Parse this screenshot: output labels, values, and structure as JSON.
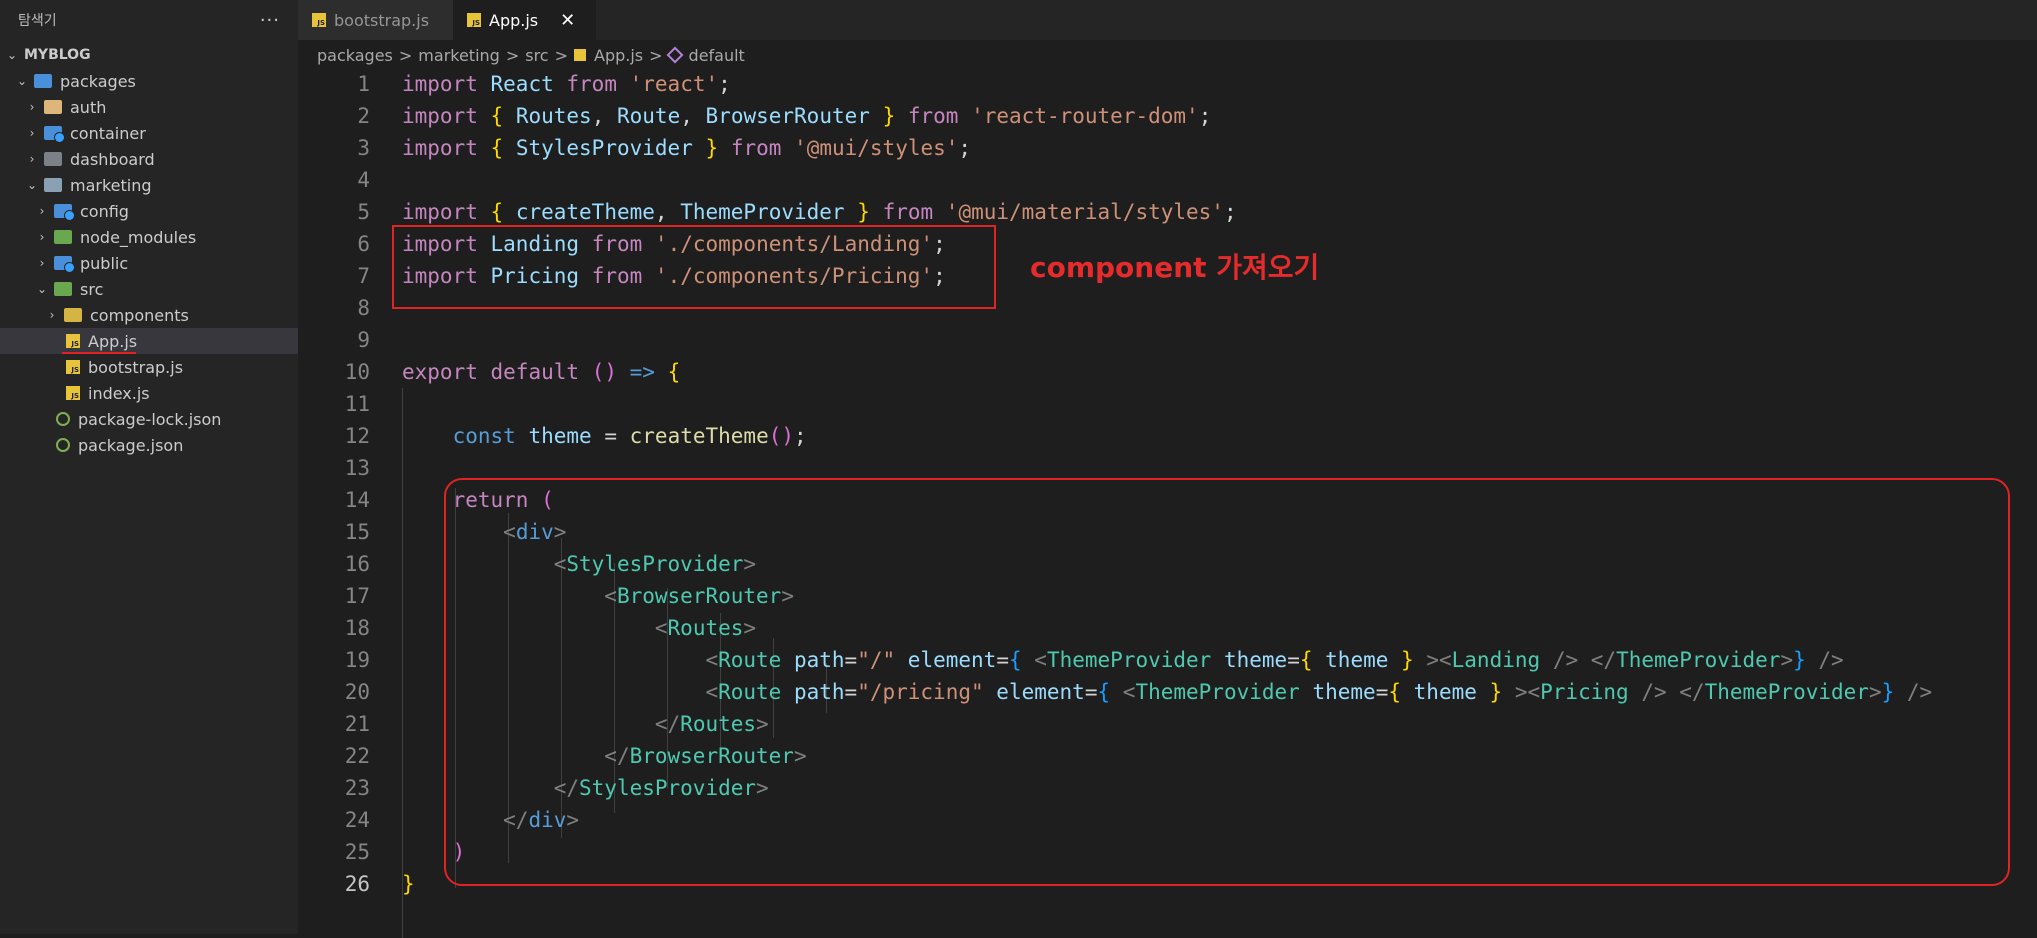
{
  "explorer": {
    "title": "탐색기",
    "more": "···",
    "workspace": "MYBLOG",
    "items": [
      {
        "label": "packages"
      },
      {
        "label": "auth"
      },
      {
        "label": "container"
      },
      {
        "label": "dashboard"
      },
      {
        "label": "marketing"
      },
      {
        "label": "config"
      },
      {
        "label": "node_modules"
      },
      {
        "label": "public"
      },
      {
        "label": "src"
      },
      {
        "label": "components"
      },
      {
        "label": "App.js"
      },
      {
        "label": "bootstrap.js"
      },
      {
        "label": "index.js"
      },
      {
        "label": "package-lock.json"
      },
      {
        "label": "package.json"
      }
    ]
  },
  "tabs": [
    {
      "label": "bootstrap.js",
      "icon": "JS"
    },
    {
      "label": "App.js",
      "icon": "JS",
      "close": "✕"
    }
  ],
  "breadcrumb": [
    "packages",
    "marketing",
    "src",
    "App.js",
    "default"
  ],
  "breadcrumb_sep": ">",
  "lines": [
    "1",
    "2",
    "3",
    "4",
    "5",
    "6",
    "7",
    "8",
    "9",
    "10",
    "11",
    "12",
    "13",
    "14",
    "15",
    "16",
    "17",
    "18",
    "19",
    "20",
    "21",
    "22",
    "23",
    "24",
    "25",
    "26"
  ],
  "annotation": "component 가져오기",
  "colors": {
    "keyword": "#c586c0",
    "variable": "#9cdcfe",
    "string": "#ce9178",
    "function": "#dcdcaa",
    "tag": "#4ec9b0",
    "annotation_red": "#e02424"
  }
}
